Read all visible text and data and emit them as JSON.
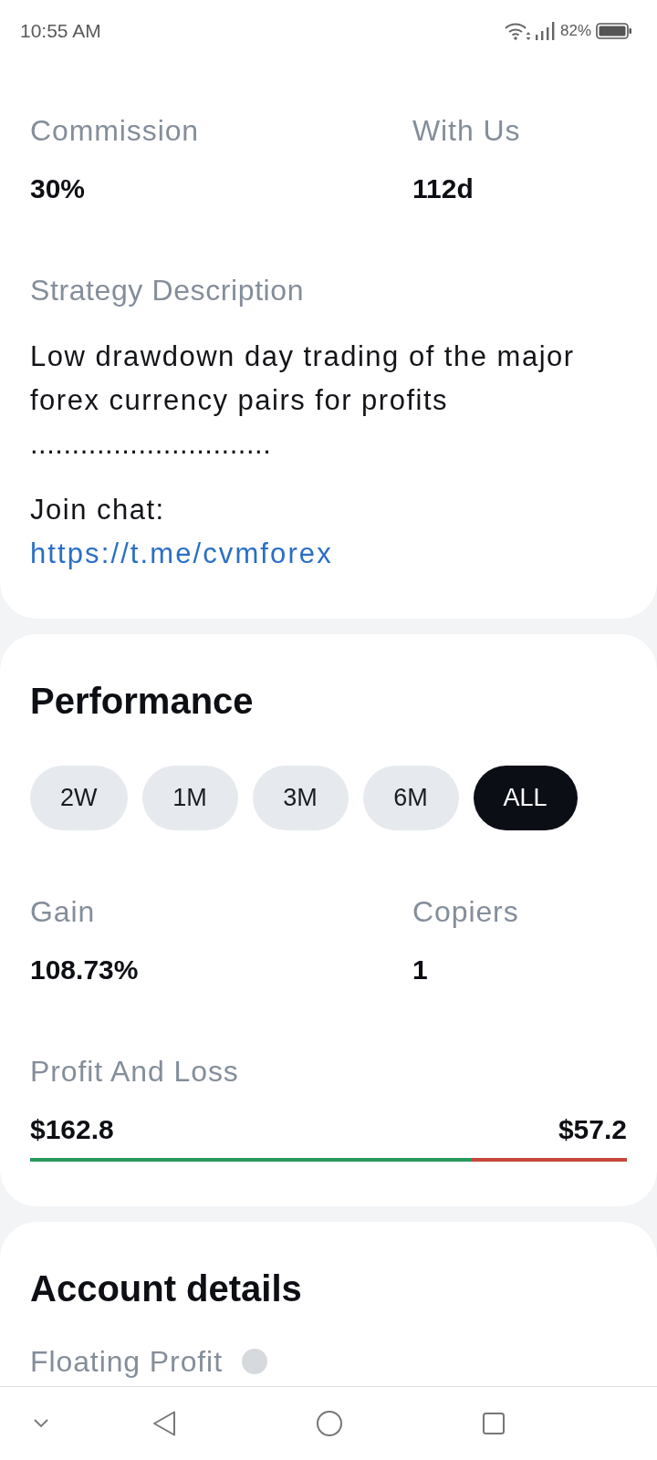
{
  "status_bar": {
    "time": "10:55 AM",
    "battery": "82%"
  },
  "overview": {
    "stats": [
      {
        "label": "Commission",
        "value": "30%"
      },
      {
        "label": "With Us",
        "value": "112d"
      }
    ],
    "strategy": {
      "label": "Strategy Description",
      "description": "Low drawdown day trading of the major forex currency pairs for profits",
      "separator": ".............................",
      "chat_label": "Join chat:",
      "chat_link": "https://t.me/cvmforex"
    }
  },
  "performance": {
    "title": "Performance",
    "periods": [
      {
        "label": "2W",
        "selected": false
      },
      {
        "label": "1M",
        "selected": false
      },
      {
        "label": "3M",
        "selected": false
      },
      {
        "label": "6M",
        "selected": false
      },
      {
        "label": "ALL",
        "selected": true
      }
    ],
    "stats": [
      {
        "label": "Gain",
        "value": "108.73%"
      },
      {
        "label": "Copiers",
        "value": "1"
      }
    ],
    "profit_and_loss": {
      "label": "Profit And Loss",
      "profit": "$162.8",
      "loss": "$57.2",
      "level": 0.74
    }
  },
  "account_details": {
    "title": "Account details",
    "fields": [
      {
        "label": "Floating Profit"
      }
    ]
  }
}
